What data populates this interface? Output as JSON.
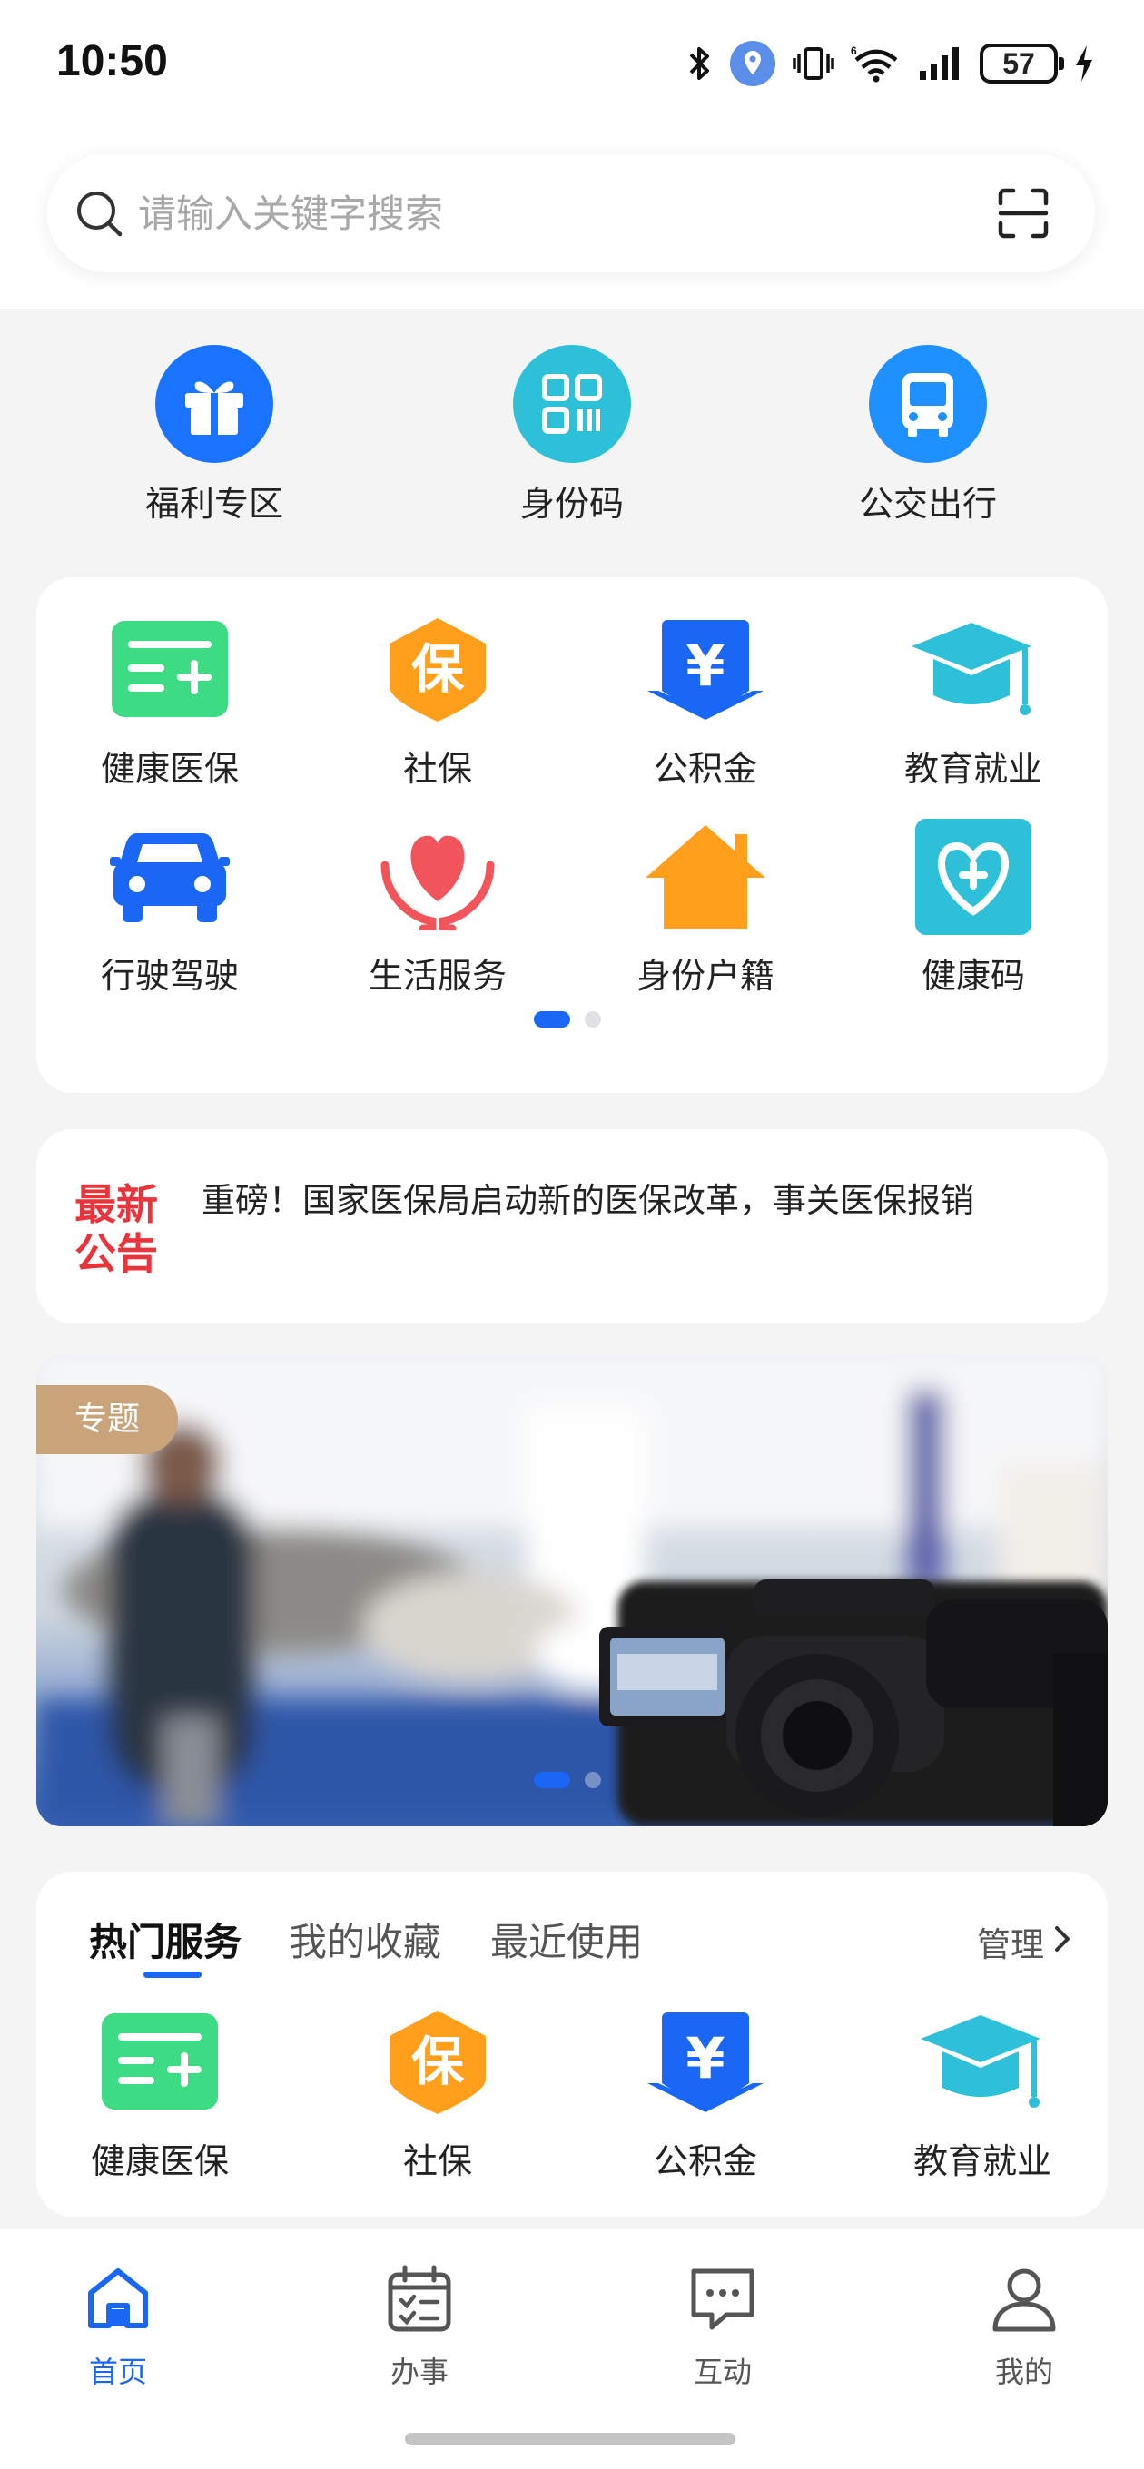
{
  "status_bar": {
    "time": "10:50",
    "battery": "57"
  },
  "search": {
    "placeholder": "请输入关键字搜索"
  },
  "top_shortcuts": [
    {
      "label": "福利专区",
      "icon": "gift-icon",
      "color": "#1a73ff"
    },
    {
      "label": "身份码",
      "icon": "qrcode-icon",
      "color": "#2ec0d8"
    },
    {
      "label": "公交出行",
      "icon": "bus-icon",
      "color": "#1e90ff"
    }
  ],
  "service_grid": [
    {
      "label": "健康医保",
      "icon": "medical-card-icon",
      "color": "#3ddc84"
    },
    {
      "label": "社保",
      "icon": "social-security-icon",
      "color": "#ff9f1c"
    },
    {
      "label": "公积金",
      "icon": "housing-fund-icon",
      "color": "#1a66f5"
    },
    {
      "label": "教育就业",
      "icon": "graduation-cap-icon",
      "color": "#2ec0d8"
    },
    {
      "label": "行驶驾驶",
      "icon": "car-icon",
      "color": "#1a66f5"
    },
    {
      "label": "生活服务",
      "icon": "heart-hands-icon",
      "color": "#f2545b"
    },
    {
      "label": "身份户籍",
      "icon": "house-icon",
      "color": "#ff9f1c"
    },
    {
      "label": "健康码",
      "icon": "health-code-icon",
      "color": "#2ec0d8"
    }
  ],
  "grid_pager": {
    "pages": 2,
    "current": 1
  },
  "notice": {
    "badge_line1": "最新",
    "badge_line2": "公告",
    "text": "重磅！国家医保局启动新的医保改革，事关医保报销"
  },
  "banner": {
    "tag": "专题",
    "pages": 2,
    "current": 1
  },
  "hot_services": {
    "tabs": [
      "热门服务",
      "我的收藏",
      "最近使用"
    ],
    "active_tab": 0,
    "manage_label": "管理",
    "items": [
      {
        "label": "健康医保",
        "icon": "medical-card-icon"
      },
      {
        "label": "社保",
        "icon": "social-security-icon"
      },
      {
        "label": "公积金",
        "icon": "housing-fund-icon"
      },
      {
        "label": "教育就业",
        "icon": "graduation-cap-icon"
      }
    ]
  },
  "bottom_nav": [
    {
      "label": "首页",
      "icon": "home-icon",
      "active": true
    },
    {
      "label": "办事",
      "icon": "calendar-tasks-icon",
      "active": false
    },
    {
      "label": "互动",
      "icon": "chat-icon",
      "active": false
    },
    {
      "label": "我的",
      "icon": "user-icon",
      "active": false
    }
  ],
  "colors": {
    "accent": "#1a66f5",
    "notice_red": "#e8343a",
    "tag_gold": "#c9a47a"
  }
}
